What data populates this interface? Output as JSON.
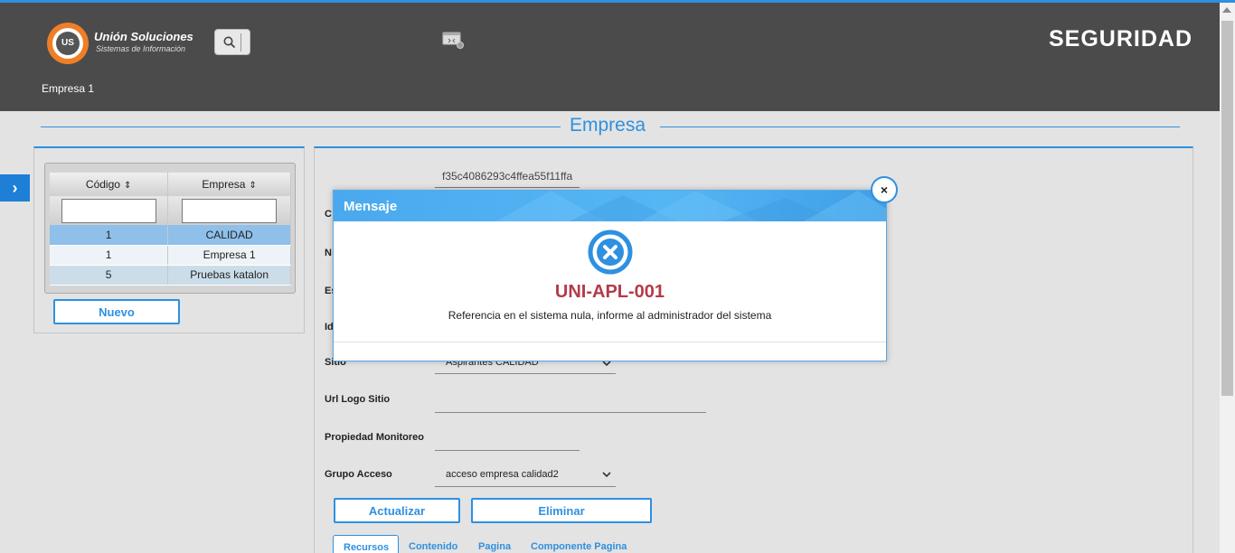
{
  "header": {
    "logo_line1": "Unión Soluciones",
    "logo_line2": "Sistemas de Información",
    "logo_mark": "US",
    "brand": "SEGURIDAD",
    "company": "Empresa 1",
    "search_icon": "search-icon",
    "settings_icon": "monitor-settings-icon"
  },
  "page": {
    "title": "Empresa"
  },
  "grid": {
    "columns": [
      "Código",
      "Empresa"
    ],
    "rows": [
      {
        "codigo": "1",
        "empresa": "CALIDAD",
        "selected": true
      },
      {
        "codigo": "1",
        "empresa": "Empresa 1",
        "selected": false
      },
      {
        "codigo": "5",
        "empresa": "Pruebas katalon",
        "selected": false
      }
    ],
    "new_button": "Nuevo"
  },
  "form": {
    "id_value": "f35c4086293c4ffea55f11ffa",
    "partial_labels": [
      "C",
      "N",
      "Es",
      "Id"
    ],
    "sitio_label": "Sitio",
    "sitio_value": "Aspirantes CALIDAD",
    "url_logo_label": "Url Logo Sitio",
    "propiedad_label": "Propiedad Monitoreo",
    "grupo_label": "Grupo Acceso",
    "grupo_value": "acceso empresa calidad2",
    "update_button": "Actualizar",
    "delete_button": "Eliminar",
    "tabs": [
      "Recursos",
      "Contenido",
      "Pagina",
      "Componente Pagina"
    ]
  },
  "modal": {
    "title": "Mensaje",
    "code": "UNI-APL-001",
    "message": "Referencia en el sistema nula, informe al administrador del sistema",
    "close_label": "×"
  },
  "colors": {
    "accent": "#2e90e0",
    "header_bg": "#4b4b4b",
    "error_code": "#b43a4a"
  }
}
